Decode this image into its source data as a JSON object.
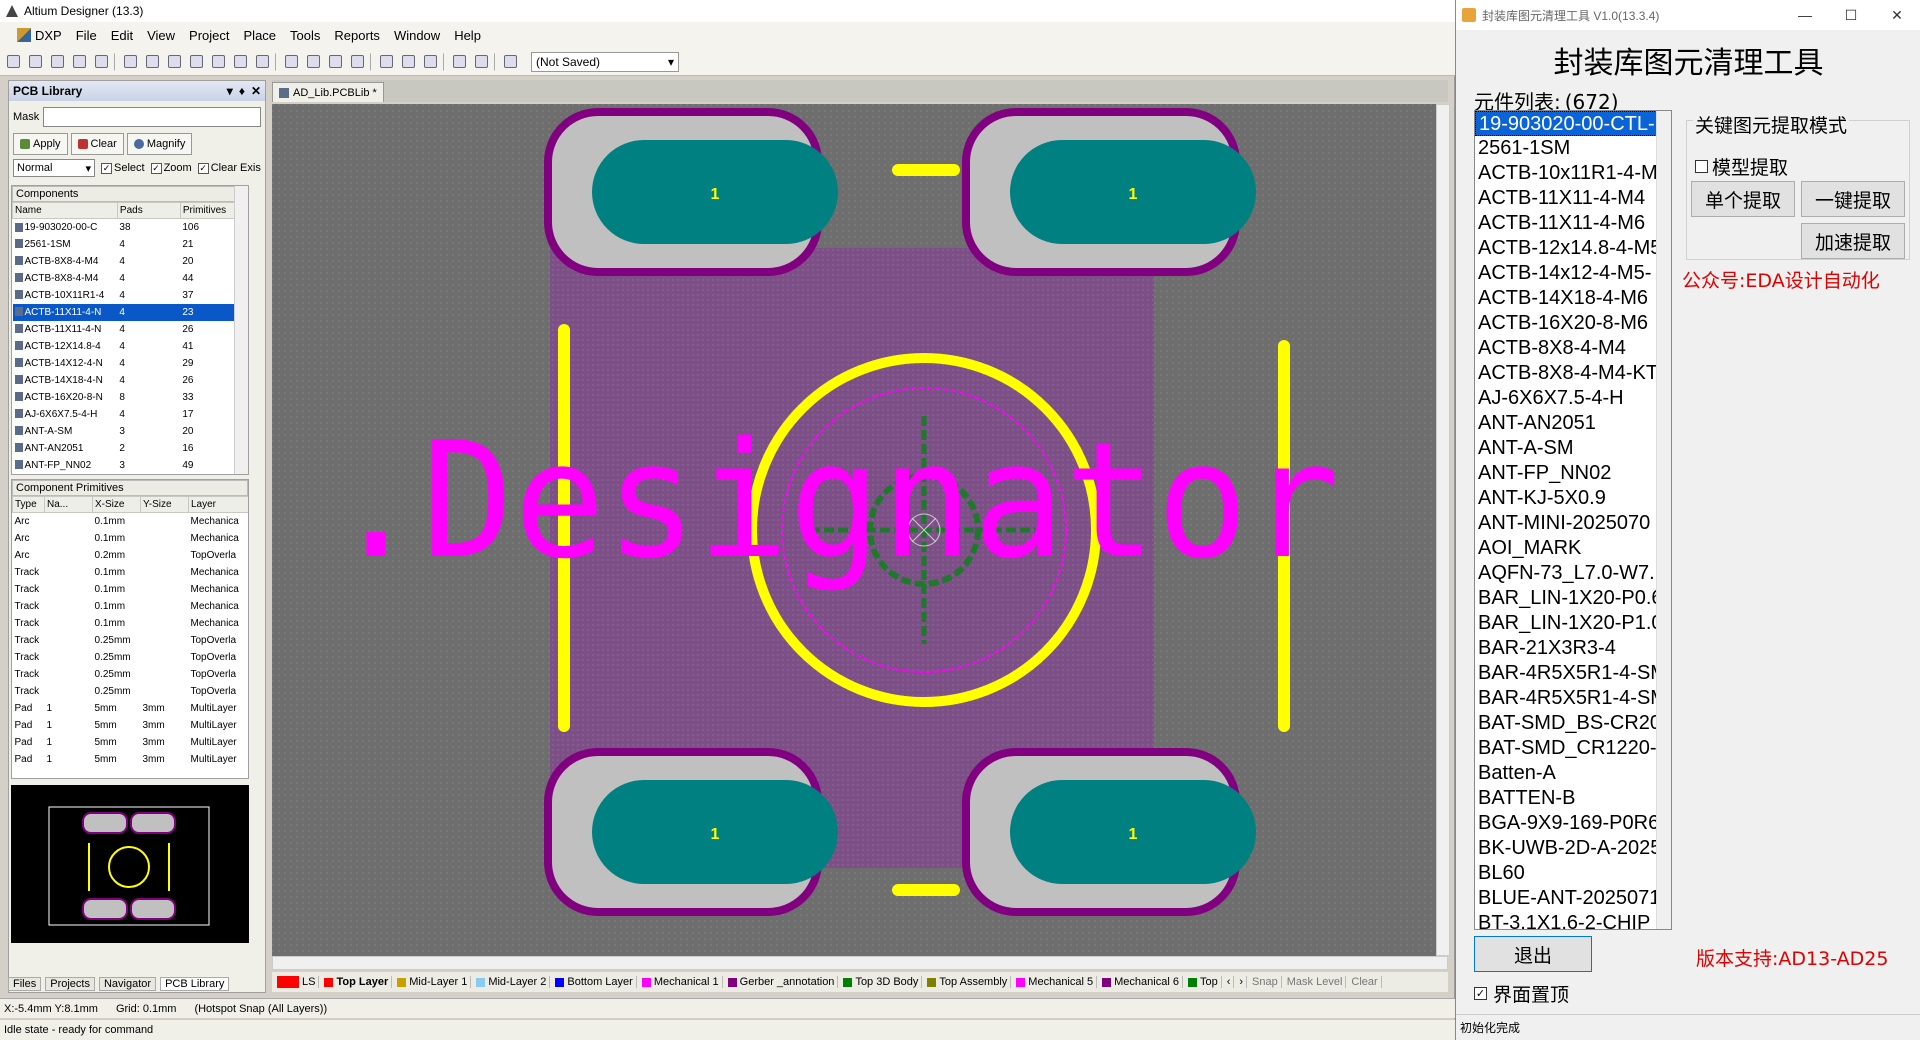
{
  "ad": {
    "window_title": "Altium Designer (13.3)",
    "menu": [
      "DXP",
      "File",
      "Edit",
      "View",
      "Project",
      "Place",
      "Tools",
      "Reports",
      "Window",
      "Help"
    ],
    "toolbar_combo": "(Not Saved)",
    "panel": {
      "title": "PCB Library",
      "mask_label": "Mask",
      "apply": "Apply",
      "clear": "Clear",
      "magnify": "Magnify",
      "mode": "Normal",
      "opt_select": "Select",
      "opt_zoom": "Zoom",
      "opt_clear": "Clear Exis",
      "components_title": "Components",
      "comp_headers": [
        "Name",
        "Pads",
        "Primitives"
      ],
      "components": [
        {
          "name": "19-903020-00-C",
          "pads": "38",
          "prims": "106"
        },
        {
          "name": "2561-1SM",
          "pads": "4",
          "prims": "21"
        },
        {
          "name": "ACTB-8X8-4-M4",
          "pads": "4",
          "prims": "20"
        },
        {
          "name": "ACTB-8X8-4-M4",
          "pads": "4",
          "prims": "44"
        },
        {
          "name": "ACTB-10X11R1-4",
          "pads": "4",
          "prims": "37"
        },
        {
          "name": "ACTB-11X11-4-N",
          "pads": "4",
          "prims": "23"
        },
        {
          "name": "ACTB-11X11-4-N",
          "pads": "4",
          "prims": "26"
        },
        {
          "name": "ACTB-12X14.8-4",
          "pads": "4",
          "prims": "41"
        },
        {
          "name": "ACTB-14X12-4-N",
          "pads": "4",
          "prims": "29"
        },
        {
          "name": "ACTB-14X18-4-N",
          "pads": "4",
          "prims": "26"
        },
        {
          "name": "ACTB-16X20-8-N",
          "pads": "8",
          "prims": "33"
        },
        {
          "name": "AJ-6X6X7.5-4-H",
          "pads": "4",
          "prims": "17"
        },
        {
          "name": "ANT-A-SM",
          "pads": "3",
          "prims": "20"
        },
        {
          "name": "ANT-AN2051",
          "pads": "2",
          "prims": "16"
        },
        {
          "name": "ANT-FP_NN02",
          "pads": "3",
          "prims": "49"
        }
      ],
      "primitives_title": "Component Primitives",
      "prim_headers": [
        "Type",
        "Na...",
        "X-Size",
        "Y-Size",
        "Layer"
      ],
      "primitives": [
        {
          "type": "Arc",
          "name": "",
          "x": "0.1mm",
          "y": "",
          "layer": "Mechanica"
        },
        {
          "type": "Arc",
          "name": "",
          "x": "0.1mm",
          "y": "",
          "layer": "Mechanica"
        },
        {
          "type": "Arc",
          "name": "",
          "x": "0.2mm",
          "y": "",
          "layer": "TopOverla"
        },
        {
          "type": "Track",
          "name": "",
          "x": "0.1mm",
          "y": "",
          "layer": "Mechanica"
        },
        {
          "type": "Track",
          "name": "",
          "x": "0.1mm",
          "y": "",
          "layer": "Mechanica"
        },
        {
          "type": "Track",
          "name": "",
          "x": "0.1mm",
          "y": "",
          "layer": "Mechanica"
        },
        {
          "type": "Track",
          "name": "",
          "x": "0.1mm",
          "y": "",
          "layer": "Mechanica"
        },
        {
          "type": "Track",
          "name": "",
          "x": "0.25mm",
          "y": "",
          "layer": "TopOverla"
        },
        {
          "type": "Track",
          "name": "",
          "x": "0.25mm",
          "y": "",
          "layer": "TopOverla"
        },
        {
          "type": "Track",
          "name": "",
          "x": "0.25mm",
          "y": "",
          "layer": "TopOverla"
        },
        {
          "type": "Track",
          "name": "",
          "x": "0.25mm",
          "y": "",
          "layer": "TopOverla"
        },
        {
          "type": "Pad",
          "name": "1",
          "x": "5mm",
          "y": "3mm",
          "layer": "MultiLayer"
        },
        {
          "type": "Pad",
          "name": "1",
          "x": "5mm",
          "y": "3mm",
          "layer": "MultiLayer"
        },
        {
          "type": "Pad",
          "name": "1",
          "x": "5mm",
          "y": "3mm",
          "layer": "MultiLayer"
        },
        {
          "type": "Pad",
          "name": "1",
          "x": "5mm",
          "y": "3mm",
          "layer": "MultiLayer"
        }
      ],
      "tabs": [
        "Files",
        "Projects",
        "Navigator",
        "PCB Library"
      ]
    },
    "doc_tab": "AD_Lib.PCBLib *",
    "canvas": {
      "designator": ".Designator",
      "pad_label": "1"
    },
    "layers": [
      {
        "name": "LS",
        "color": "#ff0000"
      },
      {
        "name": "Top Layer",
        "color": "#ff0000"
      },
      {
        "name": "Mid-Layer 1",
        "color": "#c8a000"
      },
      {
        "name": "Mid-Layer 2",
        "color": "#88ccee"
      },
      {
        "name": "Bottom Layer",
        "color": "#0000ff"
      },
      {
        "name": "Mechanical 1",
        "color": "#ff00ff"
      },
      {
        "name": "Gerber _annotation",
        "color": "#800080"
      },
      {
        "name": "Top 3D Body",
        "color": "#008000"
      },
      {
        "name": "Top Assembly",
        "color": "#808000"
      },
      {
        "name": "Mechanical 5",
        "color": "#ff00ff"
      },
      {
        "name": "Mechanical 6",
        "color": "#800080"
      },
      {
        "name": "Top",
        "color": "#008000"
      }
    ],
    "layer_right": [
      "Snap",
      "Mask Level",
      "Clear"
    ],
    "status_coords": "X:-5.4mm Y:8.1mm",
    "status_grid": "Grid: 0.1mm",
    "status_snap": "(Hotspot Snap (All Layers))",
    "status_idle": "Idle state - ready for command"
  },
  "tool": {
    "title": "封装库图元清理工具 V1.0(13.3.4)",
    "heading": "封装库图元清理工具",
    "list_label": "元件列表:",
    "list_count": "(672)",
    "items": [
      "19-903020-00-CTL-",
      "2561-1SM",
      "ACTB-10x11R1-4-M",
      "ACTB-11X11-4-M4",
      "ACTB-11X11-4-M6",
      "ACTB-12x14.8-4-M5",
      "ACTB-14x12-4-M5-",
      "ACTB-14X18-4-M6",
      "ACTB-16X20-8-M6",
      "ACTB-8X8-4-M4",
      "ACTB-8X8-4-M4-KT",
      "AJ-6X6X7.5-4-H",
      "ANT-AN2051",
      "ANT-A-SM",
      "ANT-FP_NN02",
      "ANT-KJ-5X0.9",
      "ANT-MINI-2025070",
      "AOI_MARK",
      "AQFN-73_L7.0-W7.",
      "BAR_LIN-1X20-P0.6",
      "BAR_LIN-1X20-P1.0",
      "BAR-21X3R3-4",
      "BAR-4R5X5R1-4-SM",
      "BAR-4R5X5R1-4-SM",
      "BAT-SMD_BS-CR20",
      "BAT-SMD_CR1220-",
      "Batten-A",
      "BATTEN-B",
      "BGA-9X9-169-P0R6",
      "BK-UWB-2D-A-2025",
      "BL60",
      "BLUE-ANT-2025071",
      "BT-3.1X1.6-2-CHIP"
    ],
    "group_label": "关键图元提取模式",
    "model_cb": "模型提取",
    "btn_single": "单个提取",
    "btn_oneclick": "一键提取",
    "btn_fast": "加速提取",
    "wechat": "公众号:EDA设计自动化",
    "exit": "退出",
    "version": "版本支持:AD13-AD25",
    "pin": "界面置顶",
    "status": "初始化完成"
  }
}
